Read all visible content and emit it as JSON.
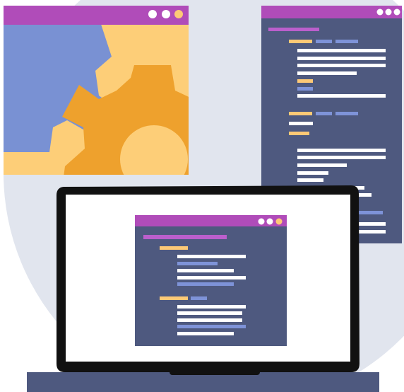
{
  "illustration": {
    "subject": "software-development-illustration",
    "elements": [
      "settings-window",
      "code-window",
      "laptop-code-window",
      "background-circle"
    ]
  },
  "colors": {
    "background_circle": "#e1e5ee",
    "window_titlebar": "#b04cb9",
    "window_dot": "#ffffff",
    "window_dot_accent": "#fdc976",
    "settings_bg": "#fdce78",
    "gear_blue": "#7991d3",
    "gear_orange": "#eea12d",
    "gear_hole": "#fdce78",
    "code_bg": "#4e597f",
    "code_line_white": "#ffffff",
    "code_line_yellow": "#fdc976",
    "code_line_blue": "#7e93d8",
    "code_line_magenta": "#bb5fcc",
    "laptop_frame": "#111111",
    "laptop_screen": "#ffffff",
    "laptop_base": "#4e597f",
    "laptop_hinge": "#111111"
  },
  "icons": {
    "window_controls": "window-dots-icon",
    "gear_large": "gear-icon",
    "gear_small": "gear-icon"
  }
}
